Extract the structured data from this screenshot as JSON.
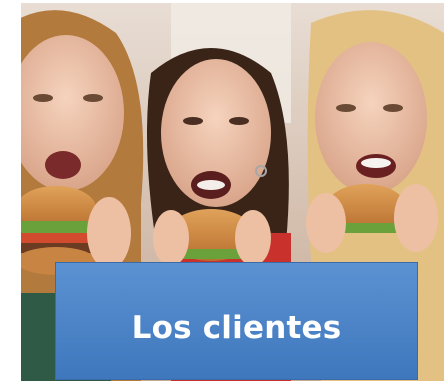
{
  "slide": {
    "caption": "Los clientes",
    "caption_bg": "#4a84c8",
    "photo_icon": "three-young-women-eating-burgers-photo"
  }
}
